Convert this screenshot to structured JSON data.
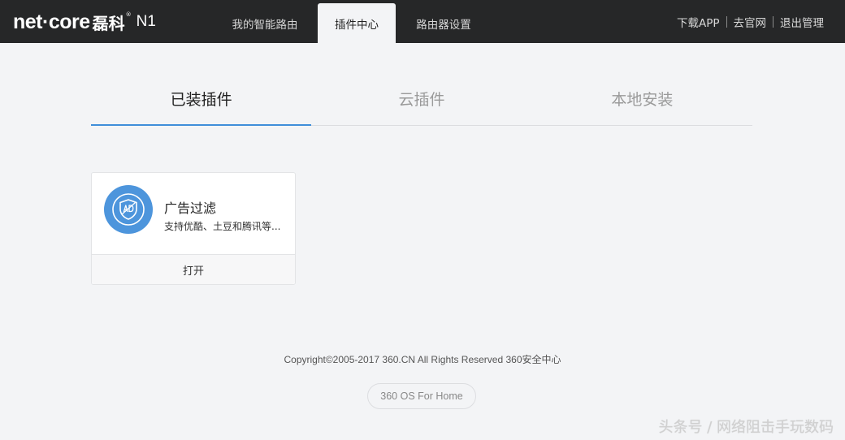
{
  "header": {
    "logo": {
      "brand": "net·core",
      "brand_cn": "磊科",
      "reg": "®",
      "model": "N1"
    },
    "nav_tabs": [
      {
        "label": "我的智能路由",
        "active": false
      },
      {
        "label": "插件中心",
        "active": true
      },
      {
        "label": "路由器设置",
        "active": false
      }
    ],
    "links": [
      "下载APP",
      "去官网",
      "退出管理"
    ]
  },
  "subtabs": [
    {
      "label": "已装插件",
      "active": true
    },
    {
      "label": "云插件",
      "active": false
    },
    {
      "label": "本地安装",
      "active": false
    }
  ],
  "plugins": [
    {
      "title": "广告过滤",
      "description": "支持优酷、土豆和腾讯等...",
      "icon": "ad-shield-icon",
      "action_label": "打开"
    }
  ],
  "footer": {
    "copyright": "Copyright©2005-2017 360.CN All Rights Reserved 360安全中心",
    "os_badge": "360 OS For Home"
  },
  "watermark": "头条号 / 网络阻击手玩数码",
  "colors": {
    "topbar": "#262728",
    "accent": "#3f8ed9",
    "icon_bg": "#4d95dc",
    "page_bg": "#f3f4f6"
  }
}
